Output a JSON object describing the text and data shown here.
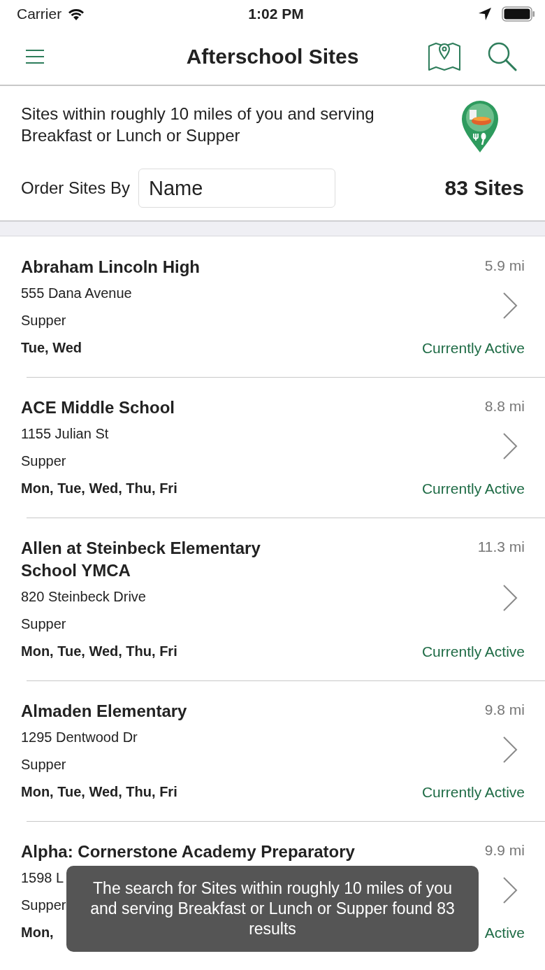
{
  "status_bar": {
    "carrier": "Carrier",
    "time": "1:02 PM"
  },
  "nav": {
    "title": "Afterschool Sites"
  },
  "filter": {
    "description": "Sites within roughly 10 miles of you and serving Breakfast or Lunch or Supper",
    "order_label": "Order Sites By",
    "order_value": "Name",
    "count": "83 Sites"
  },
  "sites": [
    {
      "name": "Abraham Lincoln High",
      "distance": "5.9 mi",
      "address": "555 Dana Avenue",
      "meal": "Supper",
      "days": "Tue, Wed",
      "status": "Currently Active"
    },
    {
      "name": "ACE Middle School",
      "distance": "8.8 mi",
      "address": "1155 Julian St",
      "meal": "Supper",
      "days": "Mon, Tue, Wed, Thu, Fri",
      "status": "Currently Active"
    },
    {
      "name": "Allen at Steinbeck Elementary School YMCA",
      "distance": "11.3 mi",
      "address": "820 Steinbeck Drive",
      "meal": "Supper",
      "days": "Mon, Tue, Wed, Thu, Fri",
      "status": "Currently Active"
    },
    {
      "name": "Almaden Elementary",
      "distance": "9.8 mi",
      "address": "1295 Dentwood Dr",
      "meal": "Supper",
      "days": "Mon, Tue, Wed, Thu, Fri",
      "status": "Currently Active"
    },
    {
      "name": "Alpha: Cornerstone Academy Preparatory",
      "distance": "9.9 mi",
      "address": "1598 L",
      "meal": "Supper",
      "days": "Mon,",
      "status": "Active"
    }
  ],
  "toast": {
    "message": "The search for Sites within roughly 10 miles of you and serving Breakfast or Lunch or Supper found 83 results"
  }
}
